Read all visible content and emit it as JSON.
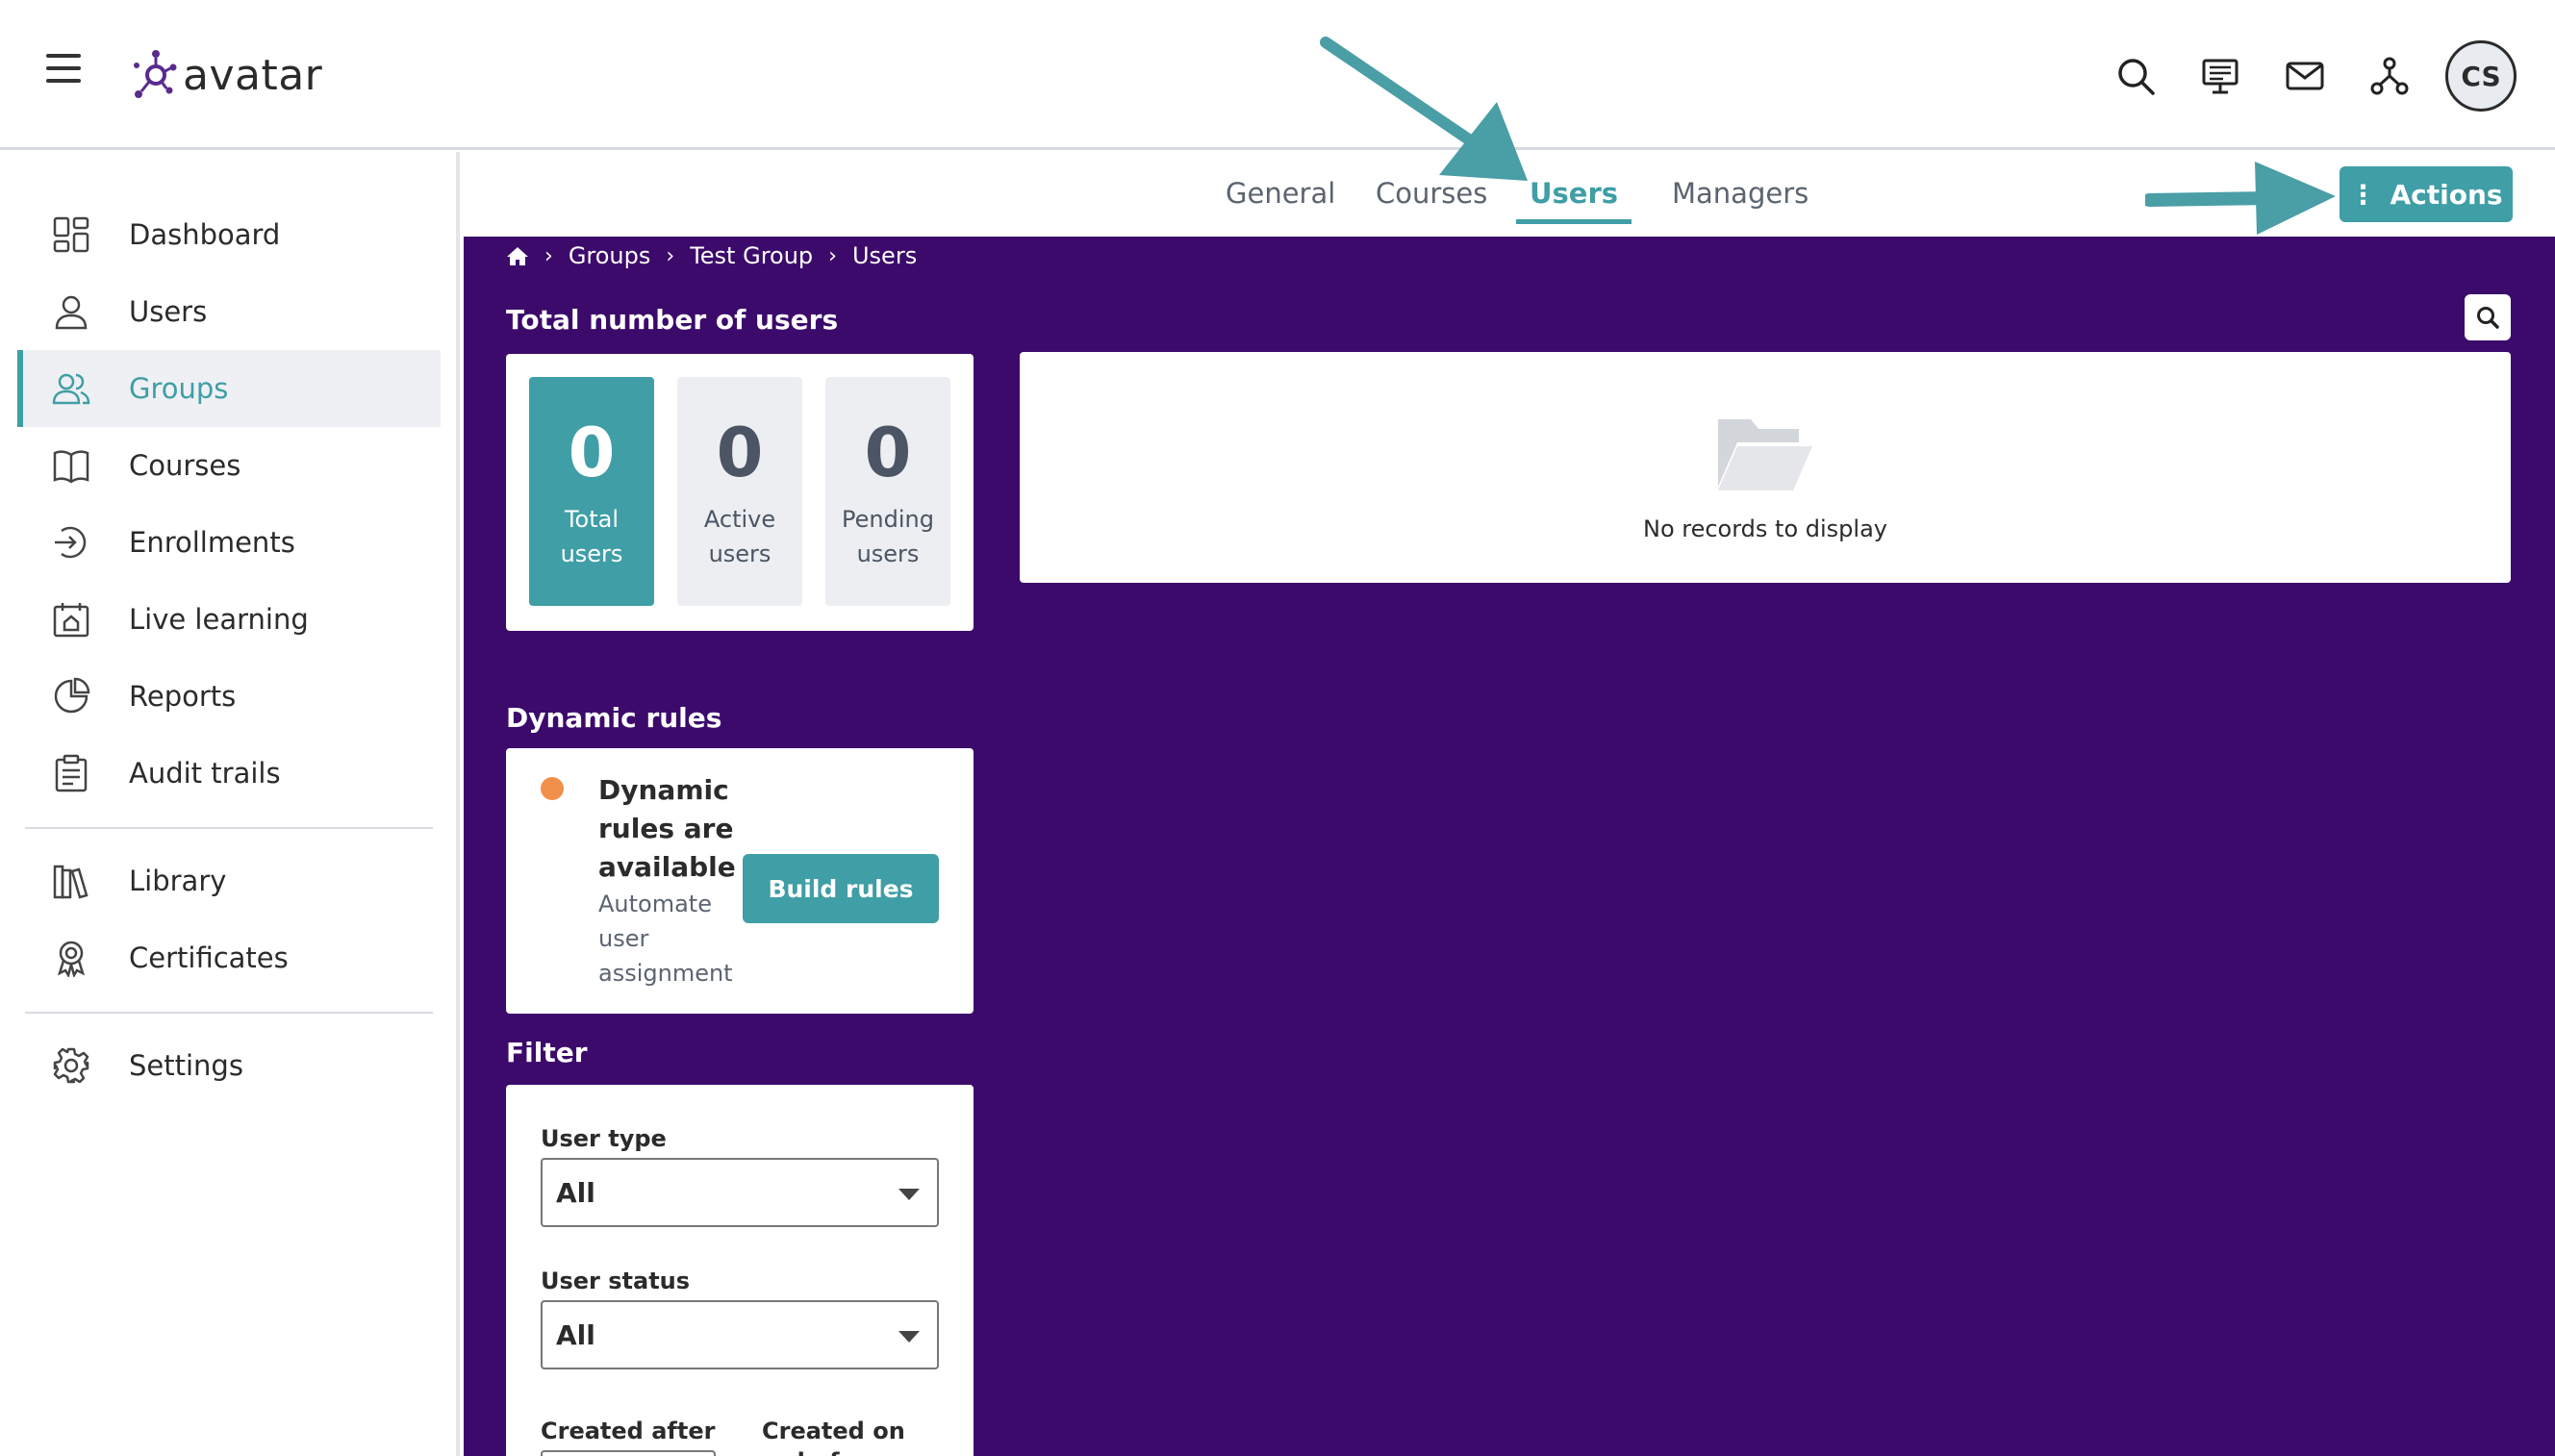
{
  "header": {
    "logo_text": "avatar",
    "avatar_initials": "CS",
    "icons": [
      "search-icon",
      "presentation-icon",
      "mail-icon",
      "network-icon"
    ]
  },
  "sidebar": {
    "items": [
      {
        "label": "Dashboard",
        "icon": "dashboard-icon"
      },
      {
        "label": "Users",
        "icon": "user-icon"
      },
      {
        "label": "Groups",
        "icon": "group-icon",
        "active": true
      },
      {
        "label": "Courses",
        "icon": "book-icon"
      },
      {
        "label": "Enrollments",
        "icon": "enroll-icon"
      },
      {
        "label": "Live learning",
        "icon": "calendar-icon"
      },
      {
        "label": "Reports",
        "icon": "pie-chart-icon"
      },
      {
        "label": "Audit trails",
        "icon": "clipboard-icon"
      },
      {
        "label": "Library",
        "icon": "library-icon"
      },
      {
        "label": "Certificates",
        "icon": "certificate-icon"
      },
      {
        "label": "Settings",
        "icon": "gear-icon"
      }
    ]
  },
  "tabs": [
    {
      "label": "General"
    },
    {
      "label": "Courses"
    },
    {
      "label": "Users",
      "active": true
    },
    {
      "label": "Managers"
    }
  ],
  "actions_label": "Actions",
  "breadcrumb": [
    "Groups",
    "Test Group",
    "Users"
  ],
  "stats": {
    "title": "Total number of users",
    "total": {
      "value": "0",
      "line1": "Total",
      "line2": "users"
    },
    "active": {
      "value": "0",
      "line1": "Active",
      "line2": "users"
    },
    "pending": {
      "value": "0",
      "line1": "Pending",
      "line2": "users"
    }
  },
  "records": {
    "empty_text": "No records to display"
  },
  "dynamic_rules": {
    "title": "Dynamic rules",
    "heading_lines": [
      "Dynamic",
      "rules are",
      "available"
    ],
    "sub_lines": [
      "Automate",
      "user",
      "assignment"
    ],
    "button": "Build rules",
    "status_color": "#f0904a"
  },
  "filter": {
    "title": "Filter",
    "user_type_label": "User type",
    "user_type_value": "All",
    "user_status_label": "User status",
    "user_status_value": "All",
    "created_after_label": "Created after",
    "created_before_label": "Created on or before"
  },
  "colors": {
    "accent": "#3f9ea6",
    "main_bg": "#3c0a6b"
  }
}
